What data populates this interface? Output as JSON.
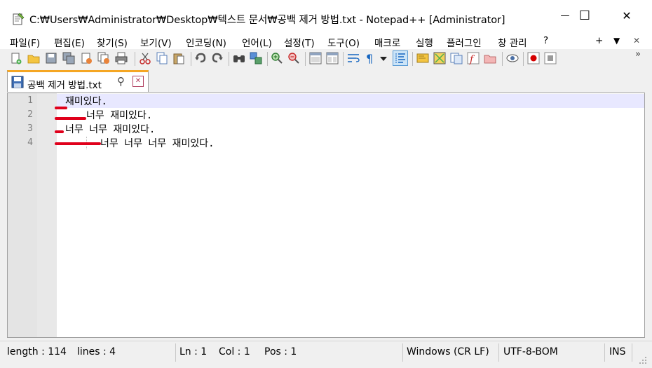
{
  "window": {
    "title": "C:₩Users₩Administrator₩Desktop₩텍스트 문서₩공백 제거 방법.txt - Notepad++ [Administrator]",
    "minimize": "—",
    "maximize": "☐",
    "close": "✕"
  },
  "menu": {
    "items": [
      "파일(F)",
      "편집(E)",
      "찾기(S)",
      "보기(V)",
      "인코딩(N)",
      "언어(L)",
      "설정(T)",
      "도구(O)",
      "매크로",
      "실행",
      "플러그인",
      "창 관리",
      "?"
    ],
    "right": [
      "+",
      "▼",
      "✕"
    ]
  },
  "tab": {
    "label": "공백 제거 방법.txt",
    "pin": "⚲",
    "close": "✕"
  },
  "editor": {
    "line_numbers": [
      "1",
      "2",
      "3",
      "4"
    ],
    "lines": [
      "재미있다.",
      "너무 재미있다.",
      "너무 너무 재미있다.",
      "너무 너무 너무 재미있다."
    ]
  },
  "status": {
    "length": "length : 114",
    "lines": "lines : 4",
    "ln": "Ln : 1",
    "col": "Col : 1",
    "pos": "Pos : 1",
    "eol": "Windows (CR LF)",
    "encoding": "UTF-8-BOM",
    "mode": "INS"
  },
  "colors": {
    "accent_tab": "#f5a623",
    "current_line": "#e8e8ff",
    "whitespace_mark": "#e0001b"
  }
}
